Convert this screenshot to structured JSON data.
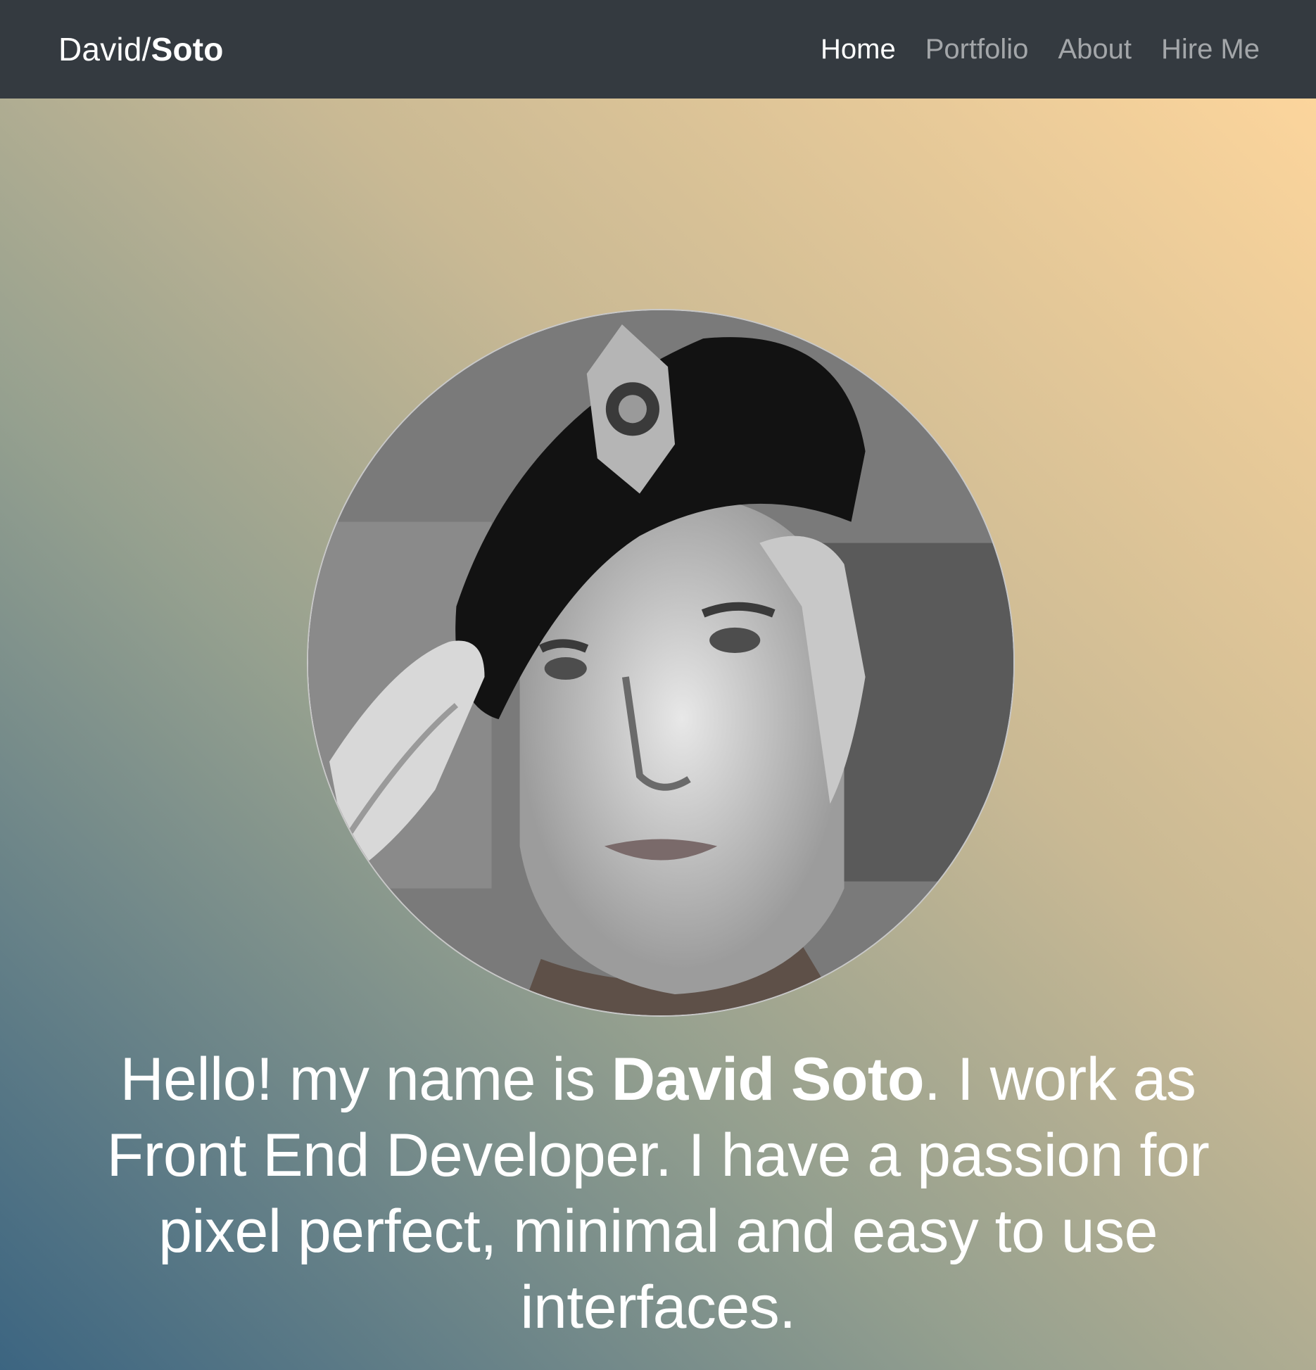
{
  "navbar": {
    "brand_first": "David/",
    "brand_second": "Soto",
    "links": [
      {
        "label": "Home",
        "active": true
      },
      {
        "label": "Portfolio",
        "active": false
      },
      {
        "label": "About",
        "active": false
      },
      {
        "label": "Hire Me",
        "active": false
      }
    ]
  },
  "hero": {
    "avatar_icon": "profile-photo",
    "intro_before": "Hello! my name is ",
    "intro_name": "David Soto",
    "intro_after": ". I work as Front End Developer. I have a passion for pixel perfect, minimal and easy to use interfaces."
  },
  "colors": {
    "navbar_bg": "#343a40",
    "nav_active": "#ffffff",
    "nav_inactive": "rgba(255,255,255,0.55)",
    "gradient_start": "#3c6581",
    "gradient_end": "#fcd59c"
  }
}
